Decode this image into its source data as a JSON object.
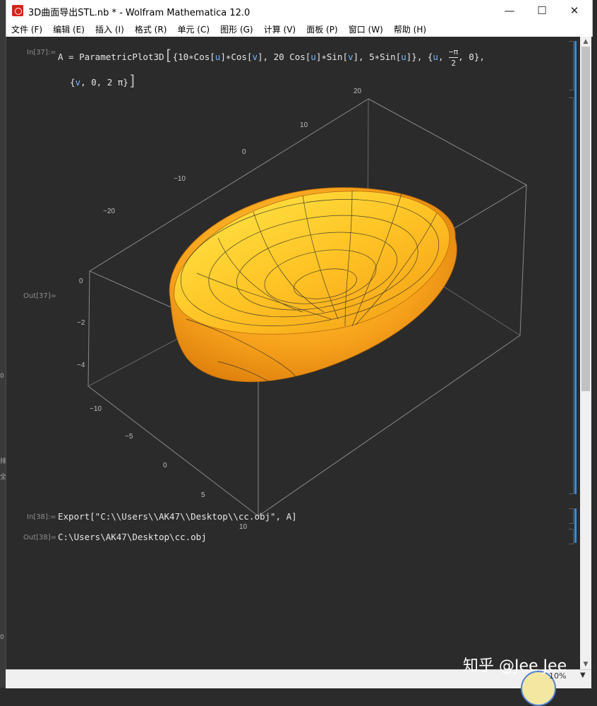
{
  "window": {
    "title": "3D曲面导出STL.nb * - Wolfram Mathematica 12.0",
    "minimize_glyph": "—",
    "maximize_glyph": "☐",
    "close_glyph": "✕"
  },
  "menu": [
    "文件 (F)",
    "编辑 (E)",
    "插入 (I)",
    "格式 (R)",
    "单元 (C)",
    "图形 (G)",
    "计算 (V)",
    "面板 (P)",
    "窗口 (W)",
    "帮助 (H)"
  ],
  "cells": {
    "in37_label": "In[37]:=",
    "in37_line1": {
      "a": "A",
      "eq": " = ",
      "fn": "ParametricPlot3D",
      "open": "[",
      "list_open": "{",
      "t1": "10∗Cos[",
      "u1": "u",
      "t2": "]∗Cos[",
      "v1": "v",
      "t3": "], 20 Cos[",
      "u2": "u",
      "t4": "]∗Sin[",
      "v2": "v",
      "t5": "], 5∗Sin[",
      "u3": "u",
      "t6": "]}, {",
      "u4": "u",
      "t7": ", ",
      "frac_num": "−π",
      "frac_den": "2",
      "t8": ", 0},"
    },
    "in37_line2": {
      "open": "{",
      "v": "v",
      "rest": ", 0, 2 π}",
      "close": "]"
    },
    "out37_label": "Out[37]=",
    "in38_label": "In[38]:=",
    "in38_code": "Export[\"C:\\\\Users\\\\AK47\\\\Desktop\\\\cc.obj\", A]",
    "out38_label": "Out[38]=",
    "out38_value": "C:\\Users\\AK47\\Desktop\\cc.obj"
  },
  "plot": {
    "surface_color": "#f5a623",
    "box_color": "#9a9a9a",
    "ticks_top": [
      "20",
      "10",
      "0",
      "−10",
      "−20"
    ],
    "ticks_left": [
      "0",
      "−2",
      "−4"
    ],
    "ticks_bottom": [
      "−10",
      "−5",
      "0",
      "5",
      "10"
    ]
  },
  "left_strip": {
    "mark1": "0",
    "mark2": "排",
    "mark3": "全",
    "mark4": "0"
  },
  "status": {
    "zoom": "10%",
    "watermark": "知乎 @Jee Jee"
  }
}
